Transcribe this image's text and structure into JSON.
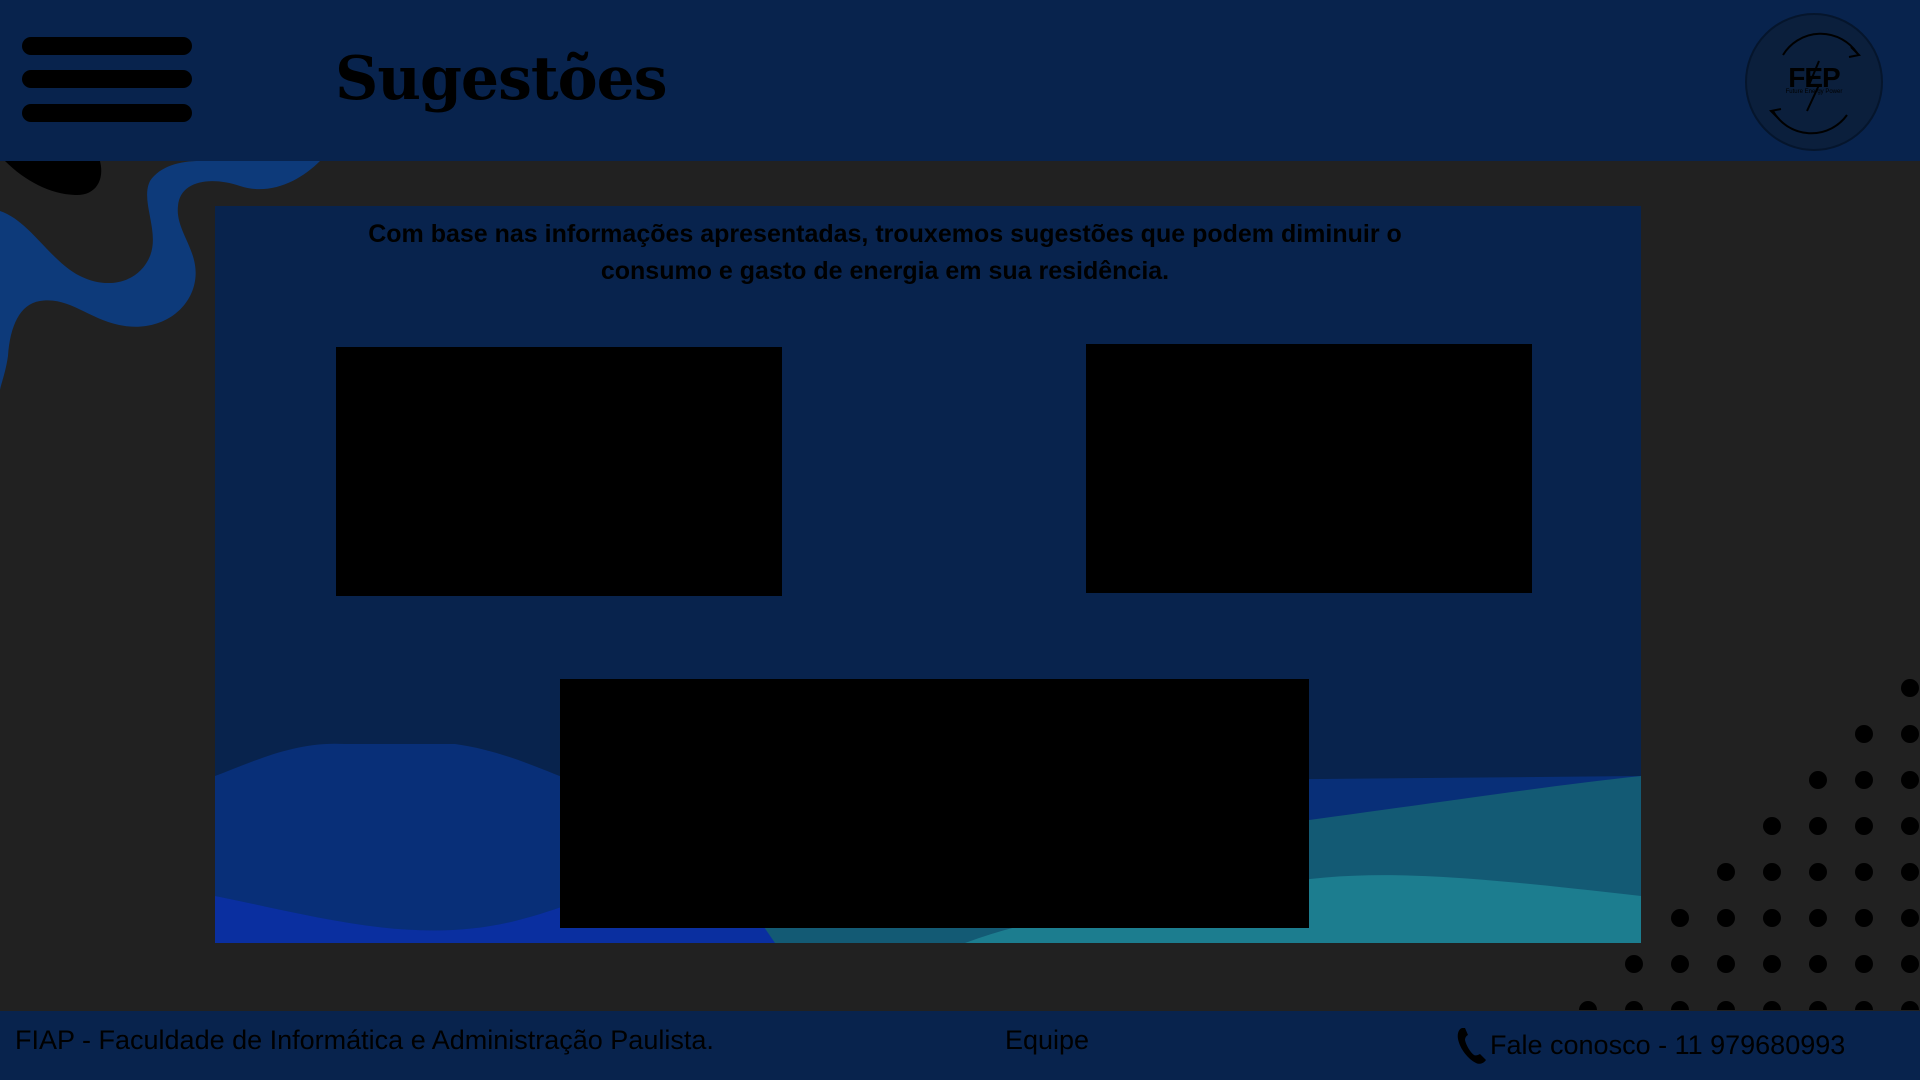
{
  "header": {
    "title": "Sugestões",
    "menu_icon": "hamburger-menu-icon",
    "logo": {
      "text": "FEP",
      "subtitle": "Future Energy Power"
    }
  },
  "main": {
    "intro": "Com base nas informações apresentadas, trouxemos sugestões que podem diminuir o consumo e gasto de energia em sua residência."
  },
  "footer": {
    "org": "FIAP - Faculdade de Informática e Administração Paulista.",
    "team_link": "Equipe",
    "contact": "Fale conosco - 11 979680993",
    "contact_icon": "phone-icon"
  },
  "colors": {
    "background": "#212121",
    "bar": "#08234d",
    "panel": "#08234d",
    "wave_blue": "#0a2fa0",
    "wave_teal": "#1c7d8f"
  }
}
